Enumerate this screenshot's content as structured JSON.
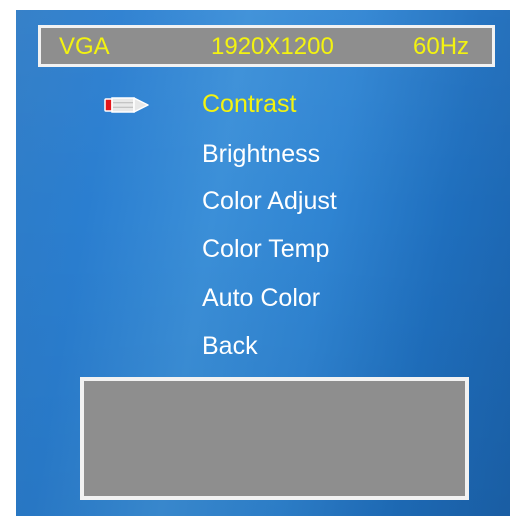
{
  "status": {
    "input": "VGA",
    "resolution": "1920X1200",
    "frequency": "60Hz"
  },
  "menu": {
    "selected_index": 0,
    "items": [
      {
        "label": "Contrast"
      },
      {
        "label": "Brightness"
      },
      {
        "label": "Color Adjust"
      },
      {
        "label": "Color Temp"
      },
      {
        "label": "Auto Color"
      },
      {
        "label": "Back"
      }
    ]
  },
  "pointer_icon": "pencil-pointer-icon",
  "colors": {
    "background": "#2f84d2",
    "selected_text": "#f3f310",
    "text": "#ffffff",
    "panel": "#8e8e8e",
    "border": "#f2f2f2",
    "pointer_tip": "#e3141a"
  }
}
